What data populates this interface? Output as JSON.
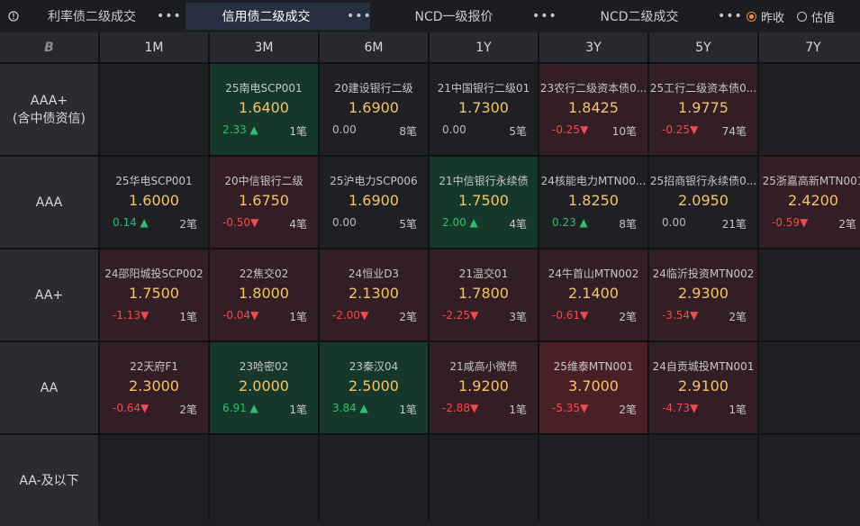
{
  "tabs": [
    {
      "label": "利率债二级成交",
      "more": "•••"
    },
    {
      "label": "信用债二级成交",
      "more": "•••"
    },
    {
      "label": "NCD一级报价",
      "more": "•••"
    },
    {
      "label": "NCD二级成交",
      "more": "•••"
    }
  ],
  "radios": [
    {
      "label": "昨收",
      "checked": true
    },
    {
      "label": "估值",
      "checked": false
    }
  ],
  "corner_logo": "B",
  "columns": [
    "1M",
    "3M",
    "6M",
    "1Y",
    "3Y",
    "5Y",
    "7Y"
  ],
  "rows": [
    {
      "label": "AAA+\n(含中债资信)",
      "cells": [
        null,
        {
          "name": "25南电SCP001",
          "price": "1.6400",
          "change": "2.33",
          "dir": "up",
          "count": "1笔",
          "bg": "green"
        },
        {
          "name": "20建设银行二级",
          "price": "1.6900",
          "change": "0.00",
          "dir": "flat",
          "count": "8笔",
          "bg": "neu"
        },
        {
          "name": "21中国银行二级01",
          "price": "1.7300",
          "change": "0.00",
          "dir": "flat",
          "count": "5笔",
          "bg": "neu"
        },
        {
          "name": "23农行二级资本债0...",
          "price": "1.8425",
          "change": "-0.25",
          "dir": "down",
          "count": "10笔",
          "bg": "dred"
        },
        {
          "name": "25工行二级资本债0...",
          "price": "1.9775",
          "change": "-0.25",
          "dir": "down",
          "count": "74笔",
          "bg": "dred"
        },
        null
      ]
    },
    {
      "label": "AAA",
      "cells": [
        {
          "name": "25华电SCP001",
          "price": "1.6000",
          "change": "0.14",
          "dir": "up",
          "count": "2笔",
          "bg": "neu"
        },
        {
          "name": "20中信银行二级",
          "price": "1.6750",
          "change": "-0.50",
          "dir": "down",
          "count": "4笔",
          "bg": "dred"
        },
        {
          "name": "25沪电力SCP006",
          "price": "1.6900",
          "change": "0.00",
          "dir": "flat",
          "count": "5笔",
          "bg": "neu"
        },
        {
          "name": "21中信银行永续债",
          "price": "1.7500",
          "change": "2.00",
          "dir": "up",
          "count": "4笔",
          "bg": "green"
        },
        {
          "name": "24核能电力MTN00...",
          "price": "1.8250",
          "change": "0.23",
          "dir": "up",
          "count": "8笔",
          "bg": "neu"
        },
        {
          "name": "25招商银行永续债0...",
          "price": "2.0950",
          "change": "0.00",
          "dir": "flat",
          "count": "21笔",
          "bg": "neu"
        },
        {
          "name": "25浙嘉高新MTN001",
          "price": "2.4200",
          "change": "-0.59",
          "dir": "down",
          "count": "2笔",
          "bg": "dred"
        }
      ]
    },
    {
      "label": "AA+",
      "cells": [
        {
          "name": "24邵阳城投SCP002",
          "price": "1.7500",
          "change": "-1.13",
          "dir": "down",
          "count": "1笔",
          "bg": "dred"
        },
        {
          "name": "22焦交02",
          "price": "1.8000",
          "change": "-0.04",
          "dir": "down",
          "count": "1笔",
          "bg": "dred"
        },
        {
          "name": "24恒业D3",
          "price": "2.1300",
          "change": "-2.00",
          "dir": "down",
          "count": "2笔",
          "bg": "dred"
        },
        {
          "name": "21温交01",
          "price": "1.7800",
          "change": "-2.25",
          "dir": "down",
          "count": "3笔",
          "bg": "dred"
        },
        {
          "name": "24牛首山MTN002",
          "price": "2.1400",
          "change": "-0.61",
          "dir": "down",
          "count": "2笔",
          "bg": "dred"
        },
        {
          "name": "24临沂投资MTN002",
          "price": "2.9300",
          "change": "-3.54",
          "dir": "down",
          "count": "2笔",
          "bg": "dred"
        },
        null
      ]
    },
    {
      "label": "AA",
      "cells": [
        {
          "name": "22天府F1",
          "price": "2.3000",
          "change": "-0.64",
          "dir": "down",
          "count": "2笔",
          "bg": "dred"
        },
        {
          "name": "23哈密02",
          "price": "2.0000",
          "change": "6.91",
          "dir": "up",
          "count": "1笔",
          "bg": "green"
        },
        {
          "name": "23秦汉04",
          "price": "2.5000",
          "change": "3.84",
          "dir": "up",
          "count": "1笔",
          "bg": "green"
        },
        {
          "name": "21咸高小微债",
          "price": "1.9200",
          "change": "-2.88",
          "dir": "down",
          "count": "1笔",
          "bg": "dred"
        },
        {
          "name": "25维泰MTN001",
          "price": "3.7000",
          "change": "-5.35",
          "dir": "down",
          "count": "2笔",
          "bg": "red"
        },
        {
          "name": "24自贡城投MTN001",
          "price": "2.9100",
          "change": "-4.73",
          "dir": "down",
          "count": "1笔",
          "bg": "dred"
        },
        null
      ]
    },
    {
      "label": "AA-及以下",
      "cells": [
        null,
        null,
        null,
        null,
        null,
        null,
        null
      ]
    }
  ],
  "colors": {
    "up": "#2fbf71",
    "down": "#ef4b52",
    "price": "#f3c46b",
    "radio_accent": "#ff8a3d"
  }
}
